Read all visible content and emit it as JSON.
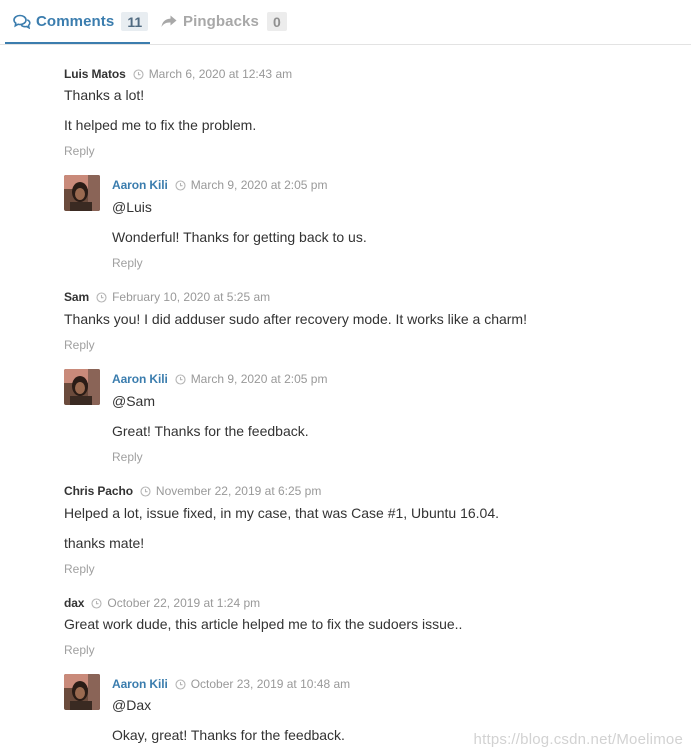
{
  "tabs": {
    "comments": {
      "label": "Comments",
      "count": "11",
      "icon": "comments-icon"
    },
    "pingbacks": {
      "label": "Pingbacks",
      "count": "0",
      "icon": "share-arrow-icon"
    }
  },
  "colors": {
    "accent": "#3b7dae",
    "muted": "#999999",
    "text": "#333333"
  },
  "comments": [
    {
      "author": "Luis Matos",
      "date": "March 6, 2020 at 12:43 am",
      "lines": [
        "Thanks a lot!",
        "It helped me to fix the problem."
      ],
      "reply_label": "Reply"
    },
    {
      "author": "Aaron Kili",
      "date": "March 9, 2020 at 2:05 pm",
      "lines": [
        "@Luis",
        "Wonderful! Thanks for getting back to us."
      ],
      "reply_label": "Reply"
    },
    {
      "author": "Sam",
      "date": "February 10, 2020 at 5:25 am",
      "lines": [
        "Thanks you! I did adduser sudo after recovery mode. It works like a charm!"
      ],
      "reply_label": "Reply"
    },
    {
      "author": "Aaron Kili",
      "date": "March 9, 2020 at 2:05 pm",
      "lines": [
        "@Sam",
        "Great! Thanks for the feedback."
      ],
      "reply_label": "Reply"
    },
    {
      "author": "Chris Pacho",
      "date": "November 22, 2019 at 6:25 pm",
      "lines": [
        "Helped a lot, issue fixed, in my case, that was Case #1, Ubuntu 16.04.",
        "thanks mate!"
      ],
      "reply_label": "Reply"
    },
    {
      "author": "dax",
      "date": "October 22, 2019 at 1:24 pm",
      "lines": [
        "Great work dude, this article helped me to fix the sudoers issue.."
      ],
      "reply_label": "Reply"
    },
    {
      "author": "Aaron Kili",
      "date": "October 23, 2019 at 10:48 am",
      "lines": [
        "@Dax",
        "Okay, great! Thanks for the feedback."
      ]
    }
  ],
  "watermark": "https://blog.csdn.net/Moelimoe"
}
